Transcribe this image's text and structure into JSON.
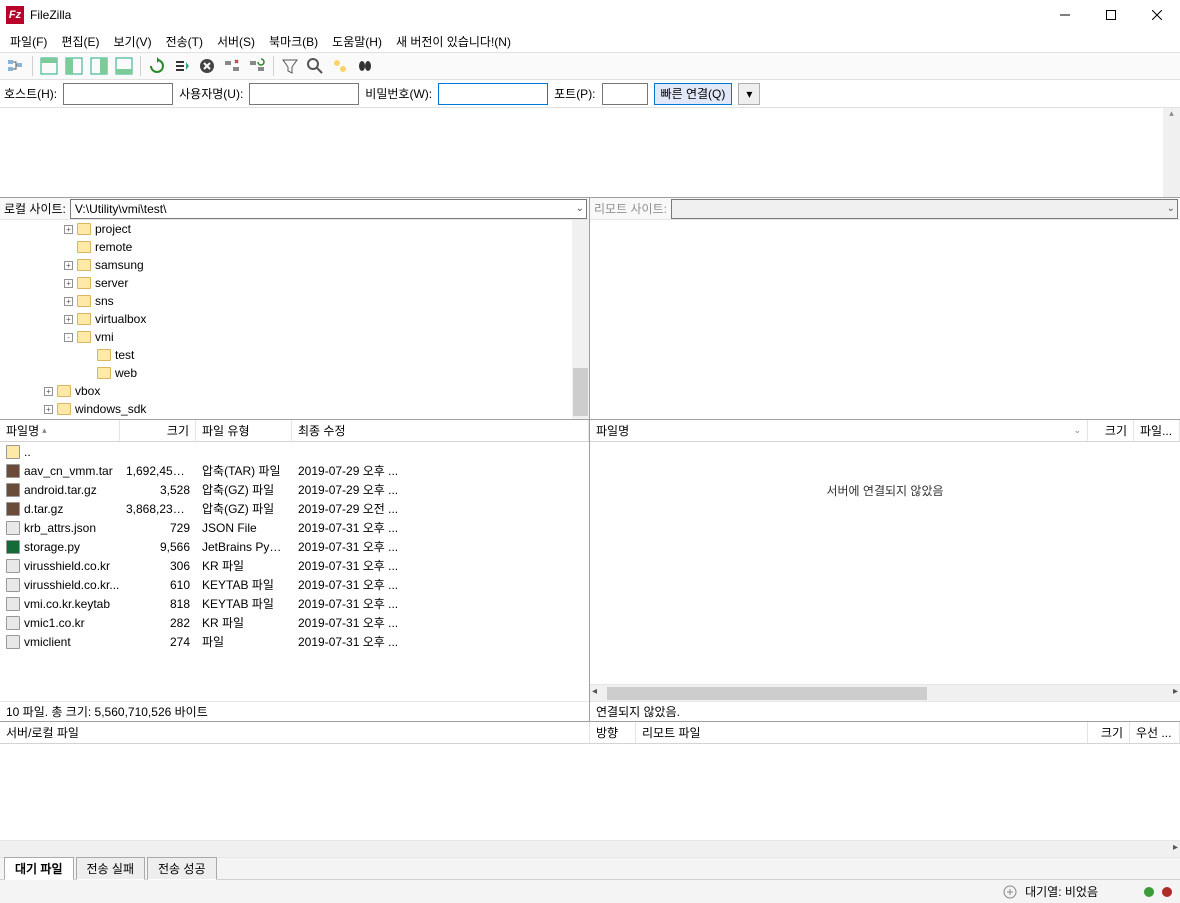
{
  "title": "FileZilla",
  "menu": [
    "파일(F)",
    "편집(E)",
    "보기(V)",
    "전송(T)",
    "서버(S)",
    "북마크(B)",
    "도움말(H)",
    "새 버전이 있습니다!(N)"
  ],
  "quick": {
    "host_lbl": "호스트(H):",
    "user_lbl": "사용자명(U):",
    "pass_lbl": "비밀번호(W):",
    "port_lbl": "포트(P):",
    "btn": "빠른 연결(Q)"
  },
  "local": {
    "lbl": "로컬 사이트:",
    "path": "V:\\Utility\\vmi\\test\\",
    "tree": [
      {
        "indent": 64,
        "exp": "+",
        "name": "project"
      },
      {
        "indent": 64,
        "exp": "",
        "name": "remote"
      },
      {
        "indent": 64,
        "exp": "+",
        "name": "samsung"
      },
      {
        "indent": 64,
        "exp": "+",
        "name": "server"
      },
      {
        "indent": 64,
        "exp": "+",
        "name": "sns"
      },
      {
        "indent": 64,
        "exp": "+",
        "name": "virtualbox"
      },
      {
        "indent": 64,
        "exp": "-",
        "name": "vmi"
      },
      {
        "indent": 84,
        "exp": "",
        "name": "test"
      },
      {
        "indent": 84,
        "exp": "",
        "name": "web"
      },
      {
        "indent": 44,
        "exp": "+",
        "name": "vbox"
      },
      {
        "indent": 44,
        "exp": "+",
        "name": "windows_sdk"
      }
    ],
    "list_headers": {
      "name": "파일명",
      "size": "크기",
      "type": "파일 유형",
      "mod": "최종 수정"
    },
    "files": [
      {
        "icon": "up",
        "name": "..",
        "size": "",
        "type": "",
        "mod": ""
      },
      {
        "icon": "tar",
        "name": "aav_cn_vmm.tar",
        "size": "1,692,458,...",
        "type": "압축(TAR) 파일",
        "mod": "2019-07-29 오후 ..."
      },
      {
        "icon": "gz",
        "name": "android.tar.gz",
        "size": "3,528",
        "type": "압축(GZ) 파일",
        "mod": "2019-07-29 오후 ..."
      },
      {
        "icon": "gz",
        "name": "d.tar.gz",
        "size": "3,868,235,...",
        "type": "압축(GZ) 파일",
        "mod": "2019-07-29 오전 ..."
      },
      {
        "icon": "file",
        "name": "krb_attrs.json",
        "size": "729",
        "type": "JSON File",
        "mod": "2019-07-31 오후 ..."
      },
      {
        "icon": "py",
        "name": "storage.py",
        "size": "9,566",
        "type": "JetBrains PyCh...",
        "mod": "2019-07-31 오후 ..."
      },
      {
        "icon": "file",
        "name": "virusshield.co.kr",
        "size": "306",
        "type": "KR 파일",
        "mod": "2019-07-31 오후 ..."
      },
      {
        "icon": "file",
        "name": "virusshield.co.kr....",
        "size": "610",
        "type": "KEYTAB 파일",
        "mod": "2019-07-31 오후 ..."
      },
      {
        "icon": "file",
        "name": "vmi.co.kr.keytab",
        "size": "818",
        "type": "KEYTAB 파일",
        "mod": "2019-07-31 오후 ..."
      },
      {
        "icon": "file",
        "name": "vmic1.co.kr",
        "size": "282",
        "type": "KR 파일",
        "mod": "2019-07-31 오후 ..."
      },
      {
        "icon": "file",
        "name": "vmiclient",
        "size": "274",
        "type": "파일",
        "mod": "2019-07-31 오후 ..."
      }
    ],
    "status": "10 파일. 총 크기: 5,560,710,526 바이트"
  },
  "remote": {
    "lbl": "리모트 사이트:",
    "list_headers": {
      "name": "파일명",
      "size": "크기",
      "type": "파일..."
    },
    "empty": "서버에 연결되지 않았음",
    "status": "연결되지 않았음."
  },
  "queue": {
    "headers": [
      "서버/로컬 파일",
      "방향",
      "리모트 파일",
      "크기",
      "우선 ..."
    ],
    "tabs": [
      "대기 파일",
      "전송 실패",
      "전송 성공"
    ]
  },
  "footer": {
    "queue_label": "대기열: 비었음"
  }
}
